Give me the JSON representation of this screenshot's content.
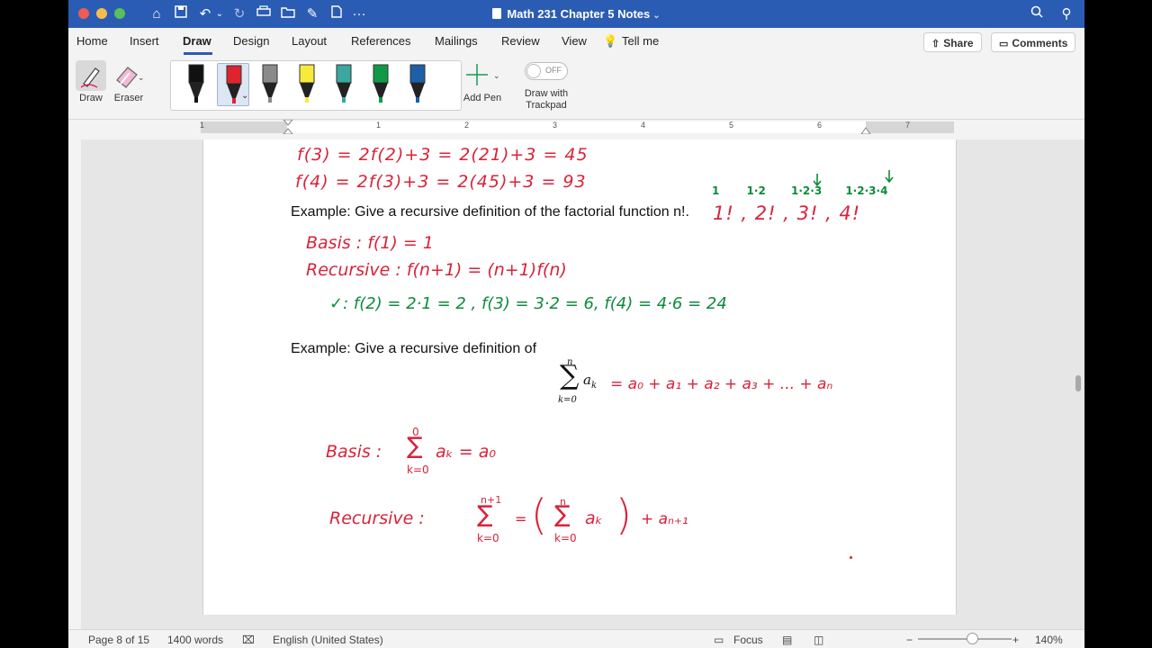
{
  "window": {
    "title": "Math 231 Chapter 5 Notes",
    "traffic_colors": [
      "#ee5c53",
      "#f5bd4f",
      "#5ac05a"
    ]
  },
  "menu": {
    "tabs": [
      "Home",
      "Insert",
      "Draw",
      "Design",
      "Layout",
      "References",
      "Mailings",
      "Review",
      "View"
    ],
    "active_tab": "Draw",
    "tell_me": "Tell me",
    "share": "Share",
    "comments": "Comments"
  },
  "ribbon": {
    "draw_label": "Draw",
    "eraser_label": "Eraser",
    "add_pen_label": "Add Pen",
    "toggle_state": "OFF",
    "draw_trackpad_line1": "Draw with",
    "draw_trackpad_line2": "Trackpad",
    "pens": [
      {
        "name": "black-pen",
        "color": "#111111"
      },
      {
        "name": "red-pen",
        "color": "#e0242f"
      },
      {
        "name": "pencil",
        "color": "#8a8a8a"
      },
      {
        "name": "highlighter",
        "color": "#f7ea3c"
      },
      {
        "name": "galaxy-pen",
        "color": "#3aa7a0"
      },
      {
        "name": "green-pen",
        "color": "#109a48"
      },
      {
        "name": "blue-pen",
        "color": "#1d5fa8"
      }
    ]
  },
  "ruler": {
    "marks": [
      "1",
      "1",
      "2",
      "3",
      "4",
      "5",
      "6",
      "7"
    ]
  },
  "document": {
    "example1": "Example: Give a recursive definition of the factorial function n!.",
    "example2": "Example: Give a recursive definition of",
    "sum_upper": "n",
    "sum_lower": "k=0",
    "sum_term": "a",
    "sum_sub": "k",
    "ink": {
      "line_f3": "f(3) = 2f(2)+3  =  2(21)+3 = 45",
      "line_f4": "f(4) = 2f(3)+3  =  2(45)+3 = 93",
      "basis1": "Basis : f(1) = 1",
      "recursive1": "Recursive : f(n+1) = (n+1)f(n)",
      "check": "✓: f(2) = 2·1 = 2  , f(3) = 3·2 = 6, f(4) = 4·6 = 24",
      "fact_top": [
        "1",
        "1·2",
        "1·2·3",
        "1·2·3·4"
      ],
      "fact_bottom": "1! , 2! , 3! , 4!",
      "series": "= a₀ + a₁ + a₂ + a₃ + ... + aₙ",
      "basis2_label": "Basis :",
      "basis2_rhs": "aₖ = a₀",
      "basis2_upper": "0",
      "basis2_lower": "k=0",
      "recursive2_label": "Recursive :",
      "recursive2_upper": "n+1",
      "recursive2_lower": "k=0",
      "recursive2_inner_upper": "n",
      "recursive2_inner_lower": "k=0",
      "recursive2_eq": "=",
      "recursive2_inner": "aₖ",
      "recursive2_tail": "+ aₙ₊₁",
      "colors": {
        "red": "#d8233a",
        "green": "#0f8a3c"
      }
    }
  },
  "status": {
    "page": "Page 8 of 15",
    "words": "1400 words",
    "language": "English (United States)",
    "focus": "Focus",
    "zoom": "140%"
  }
}
